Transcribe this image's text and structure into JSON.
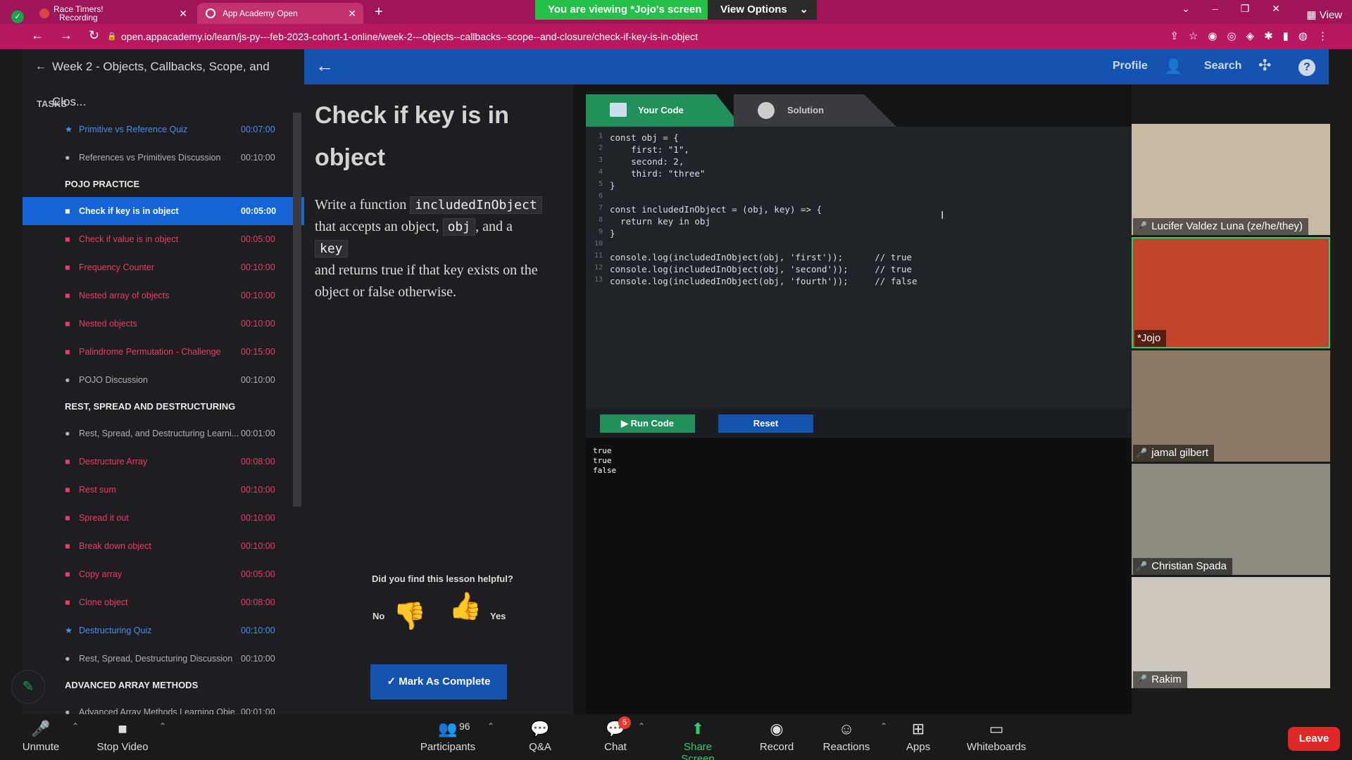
{
  "browser": {
    "tabs": [
      {
        "label_line1": "Race Timers!",
        "label_line2": "Recording"
      },
      {
        "label": "App Academy Open"
      }
    ],
    "url": "open.appacademy.io/learn/js-py---feb-2023-cohort-1-online/week-2---objects--callbacks--scope--and-closure/check-if-key-is-in-object",
    "share_banner": "You are viewing *Jojo's screen",
    "view_options": "View Options",
    "view_label": "View"
  },
  "sidebar": {
    "week_title": "Week 2 - Objects, Callbacks, Scope, and Clos...",
    "tasks_heading": "TASKS",
    "items": [
      {
        "kind": "task",
        "style": "blue",
        "bullet": "★",
        "name": "Primitive vs Reference Quiz",
        "time": "00:07:00"
      },
      {
        "kind": "task",
        "style": "gray",
        "bullet": "●",
        "name": "References vs Primitives Discussion",
        "time": "00:10:00"
      },
      {
        "kind": "section",
        "name": "POJO PRACTICE"
      },
      {
        "kind": "task",
        "style": "active",
        "bullet": "■",
        "name": "Check if key is in object",
        "time": "00:05:00"
      },
      {
        "kind": "task",
        "style": "red",
        "bullet": "■",
        "name": "Check if value is in object",
        "time": "00:05:00"
      },
      {
        "kind": "task",
        "style": "red",
        "bullet": "■",
        "name": "Frequency Counter",
        "time": "00:10:00"
      },
      {
        "kind": "task",
        "style": "red",
        "bullet": "■",
        "name": "Nested array of objects",
        "time": "00:10:00"
      },
      {
        "kind": "task",
        "style": "red",
        "bullet": "■",
        "name": "Nested objects",
        "time": "00:10:00"
      },
      {
        "kind": "task",
        "style": "red",
        "bullet": "■",
        "name": " Palindrome Permutation - Challenge",
        "time": "00:15:00"
      },
      {
        "kind": "task",
        "style": "gray",
        "bullet": "●",
        "name": "POJO Discussion",
        "time": "00:10:00"
      },
      {
        "kind": "section",
        "name": "REST, SPREAD AND DESTRUCTURING"
      },
      {
        "kind": "task",
        "style": "gray",
        "bullet": "●",
        "name": "Rest, Spread, and Destructuring Learni...",
        "time": "00:01:00"
      },
      {
        "kind": "task",
        "style": "red",
        "bullet": "■",
        "name": "Destructure Array",
        "time": "00:08:00"
      },
      {
        "kind": "task",
        "style": "red",
        "bullet": "■",
        "name": "Rest sum",
        "time": "00:10:00"
      },
      {
        "kind": "task",
        "style": "red",
        "bullet": "■",
        "name": "Spread it out",
        "time": "00:10:00"
      },
      {
        "kind": "task",
        "style": "red",
        "bullet": "■",
        "name": "Break down object",
        "time": "00:10:00"
      },
      {
        "kind": "task",
        "style": "red",
        "bullet": "■",
        "name": "Copy array",
        "time": "00:05:00"
      },
      {
        "kind": "task",
        "style": "red",
        "bullet": "■",
        "name": "Clone object",
        "time": "00:08:00"
      },
      {
        "kind": "task",
        "style": "blue",
        "bullet": "★",
        "name": "Destructuring Quiz",
        "time": "00:10:00"
      },
      {
        "kind": "task",
        "style": "gray",
        "bullet": "●",
        "name": "Rest, Spread, Destructuring Discussion",
        "time": "00:10:00"
      },
      {
        "kind": "section",
        "name": "ADVANCED ARRAY METHODS"
      },
      {
        "kind": "task",
        "style": "gray",
        "bullet": "●",
        "name": "Advanced Array Methods Learning Obje...",
        "time": "00:01:00"
      }
    ]
  },
  "topbar": {
    "profile": "Profile",
    "search": "Search",
    "help": "?"
  },
  "lesson": {
    "title": "Check if key is in object",
    "p1": "Write a function",
    "fn": "includedInObject",
    "p2": "that accepts an object,",
    "obj": "obj",
    "p3": ", and a",
    "key": "key",
    "p4": "and returns true if that key exists on the object or false otherwise.",
    "helpful_q": "Did you find this lesson helpful?",
    "no": "No",
    "yes": "Yes",
    "mark_complete": "✓ Mark As Complete"
  },
  "code": {
    "tab_yours": "Your Code",
    "tab_solution": "Solution",
    "lines": [
      {
        "n": "1",
        "t": "const obj = {"
      },
      {
        "n": "2",
        "t": "    first: \"1\","
      },
      {
        "n": "3",
        "t": "    second: 2,"
      },
      {
        "n": "4",
        "t": "    third: \"three\""
      },
      {
        "n": "5",
        "t": "}"
      },
      {
        "n": "6",
        "t": ""
      },
      {
        "n": "7",
        "t": "const includedInObject = (obj, key) => {"
      },
      {
        "n": "8",
        "t": "  return key in obj"
      },
      {
        "n": "9",
        "t": "}"
      },
      {
        "n": "10",
        "t": ""
      },
      {
        "n": "11",
        "t": "console.log(includedInObject(obj, 'first'));      // true"
      },
      {
        "n": "12",
        "t": "console.log(includedInObject(obj, 'second'));     // true"
      },
      {
        "n": "13",
        "t": "console.log(includedInObject(obj, 'fourth'));     // false"
      }
    ],
    "run": "▶ Run Code",
    "reset": "Reset",
    "output": [
      "true",
      "true",
      "false"
    ]
  },
  "participants": [
    {
      "name": "Lucifer Valdez Luna (ze/he/they)",
      "muted": true,
      "bg": "#c8b9a6"
    },
    {
      "name": "*Jojo",
      "muted": false,
      "bg": "#c0442c",
      "speaking": true
    },
    {
      "name": "jamal gilbert",
      "muted": true,
      "bg": "#8c7a66"
    },
    {
      "name": "Christian Spada",
      "muted": true,
      "bg": "#8f8a80"
    },
    {
      "name": "Rakim",
      "muted": true,
      "bg": "#cdc6bb"
    }
  ],
  "zoom": {
    "unmute": "Unmute",
    "stop_video": "Stop Video",
    "participants": "Participants",
    "participant_count": "96",
    "qa": "Q&A",
    "chat": "Chat",
    "chat_badge": "5",
    "share_screen": "Share Screen",
    "record": "Record",
    "reactions": "Reactions",
    "apps": "Apps",
    "whiteboards": "Whiteboards",
    "leave": "Leave"
  }
}
